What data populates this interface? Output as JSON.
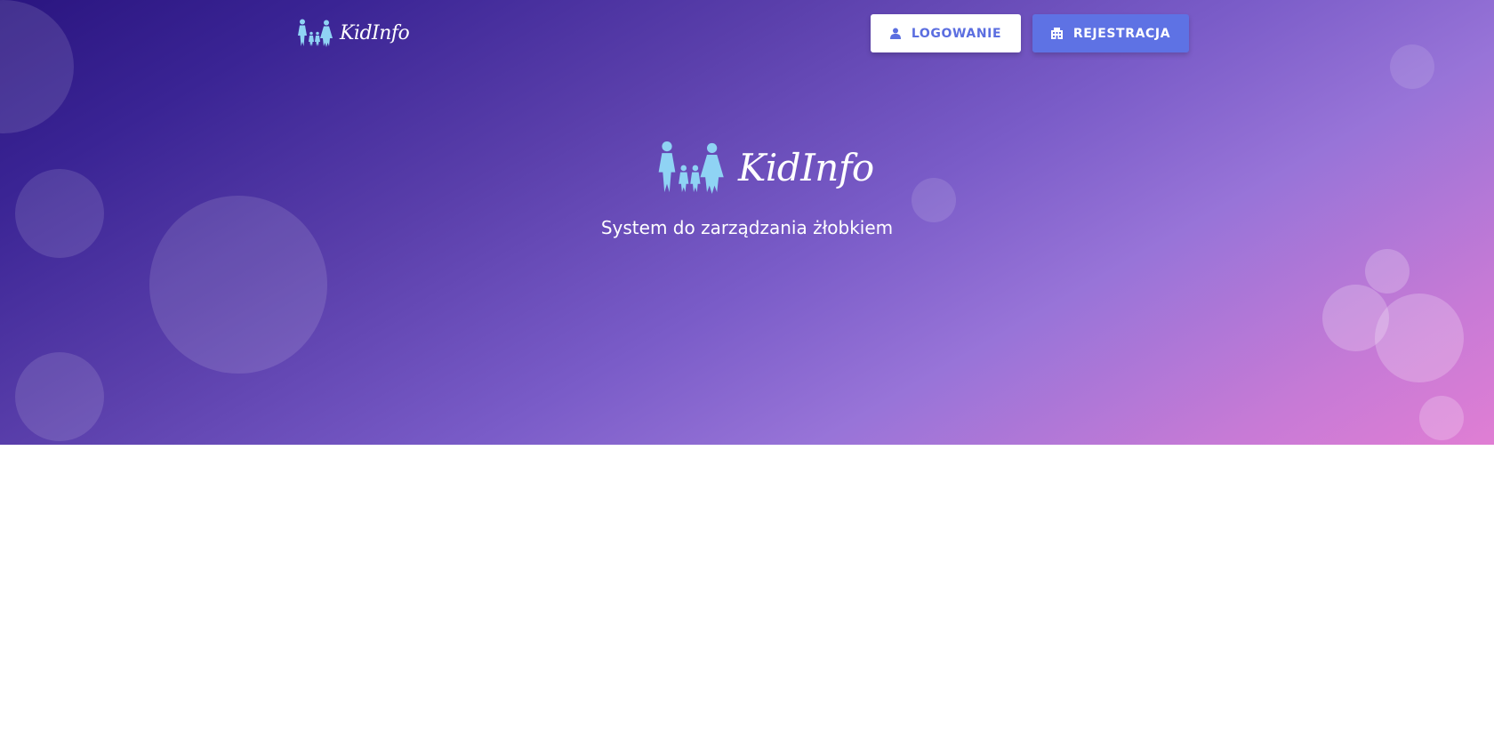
{
  "header": {
    "brand_name": "KidInfo",
    "login_label": "LOGOWANIE",
    "register_label": "REJESTRACJA"
  },
  "hero": {
    "brand_name": "KidInfo",
    "tagline": "System do zarządzania żłobkiem"
  },
  "icons": {
    "login": "user-icon",
    "register": "building-icon",
    "logo": "family-logo-icon"
  },
  "colors": {
    "accent": "#5e72e4",
    "logo_figure": "#8fd3f4",
    "gradient_start": "#2a1580",
    "gradient_end": "#e07ed4"
  }
}
